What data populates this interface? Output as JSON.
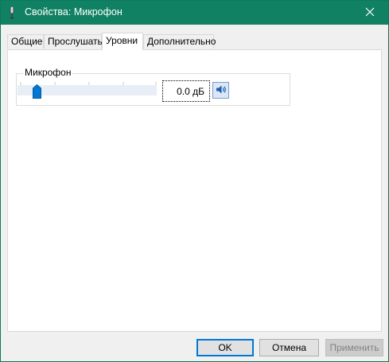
{
  "window": {
    "title": "Свойства: Микрофон",
    "title_icon": "microphone-icon",
    "close_icon": "close-icon",
    "titlebar_color": "#118163"
  },
  "tabs": [
    {
      "label": "Общие",
      "selected": false
    },
    {
      "label": "Прослушать",
      "selected": false
    },
    {
      "label": "Уровни",
      "selected": true
    },
    {
      "label": "Дополнительно",
      "selected": false
    }
  ],
  "levels": {
    "group_label": "Микрофон",
    "slider_value_fraction": 0.0,
    "level_text": "0.0 дБ",
    "mute_icon": "speaker-icon"
  },
  "buttons": {
    "ok": "OK",
    "cancel": "Отмена",
    "apply": "Применить",
    "apply_enabled": false,
    "accent": "#0078d7"
  }
}
